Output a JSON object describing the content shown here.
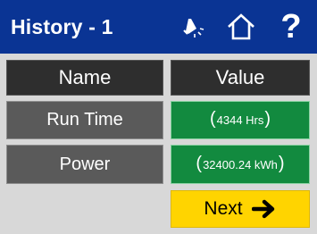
{
  "header": {
    "title": "History - 1",
    "icons": [
      "alarm-bell-icon",
      "home-icon",
      "help-icon"
    ],
    "help_glyph": "?"
  },
  "table": {
    "columns": [
      "Name",
      "Value"
    ],
    "rows": [
      {
        "name": "Run Time",
        "value": "4344 Hrs"
      },
      {
        "name": "Power",
        "value": "32400.24 kWh"
      }
    ]
  },
  "next_button": {
    "label": "Next",
    "icon": "arrow-right-icon"
  },
  "colors": {
    "header_bg": "#0a3494",
    "screen_bg": "#d8d8d8",
    "column_header_bg": "#2e2e2e",
    "name_cell_bg": "#5a5a5a",
    "value_cell_bg": "#128a3f",
    "next_button_bg": "#ffd400"
  }
}
